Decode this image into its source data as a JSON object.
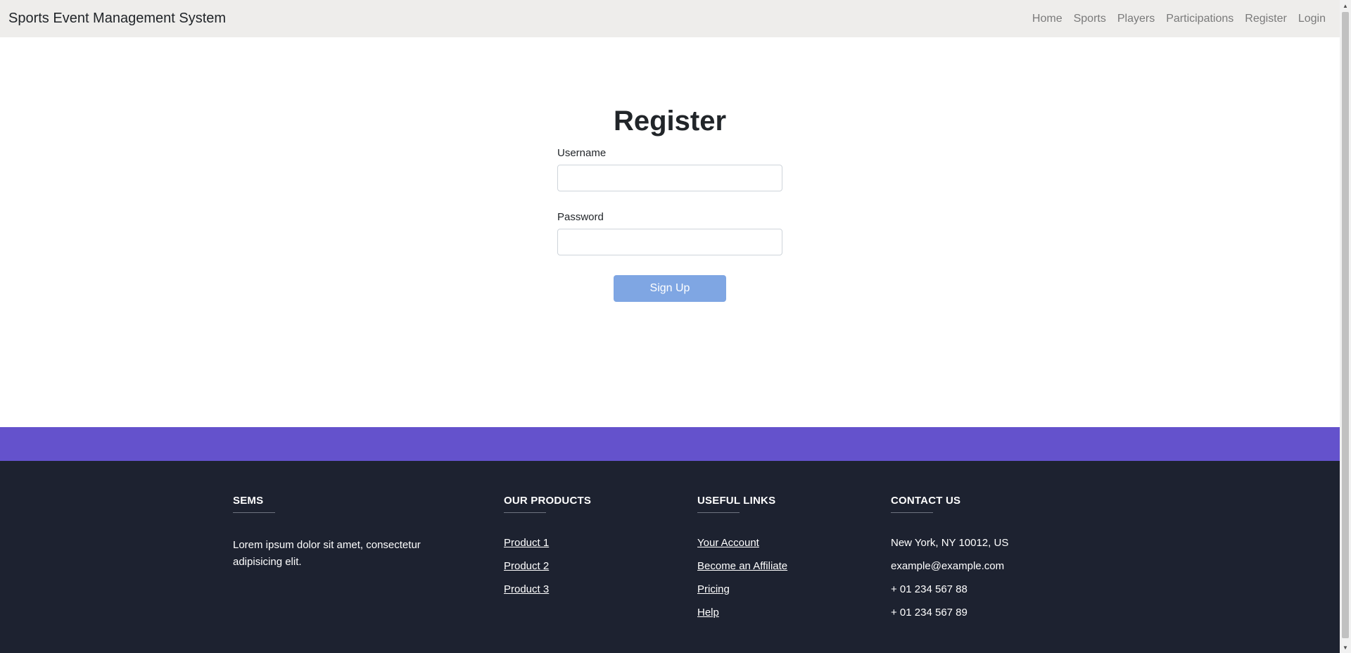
{
  "navbar": {
    "brand": "Sports Event Management System",
    "links": [
      "Home",
      "Sports",
      "Players",
      "Participations",
      "Register",
      "Login"
    ]
  },
  "form": {
    "title": "Register",
    "username_label": "Username",
    "username_value": "",
    "password_label": "Password",
    "password_value": "",
    "submit_label": "Sign Up",
    "submit_color": "#7fa6e3"
  },
  "footer": {
    "band_color": "#6452cc",
    "bg_color": "#1d2230",
    "sems": {
      "heading": "SEMS",
      "text": "Lorem ipsum dolor sit amet, consectetur adipisicing elit."
    },
    "products": {
      "heading": "OUR PRODUCTS",
      "items": [
        "Product 1",
        "Product 2",
        "Product 3"
      ]
    },
    "useful_links": {
      "heading": "USEFUL LINKS",
      "items": [
        "Your Account",
        "Become an Affiliate",
        "Pricing",
        "Help"
      ]
    },
    "contact": {
      "heading": "CONTACT US",
      "items": [
        "New York, NY 10012, US",
        "example@example.com",
        "+ 01 234 567 88",
        "+ 01 234 567 89"
      ]
    }
  }
}
